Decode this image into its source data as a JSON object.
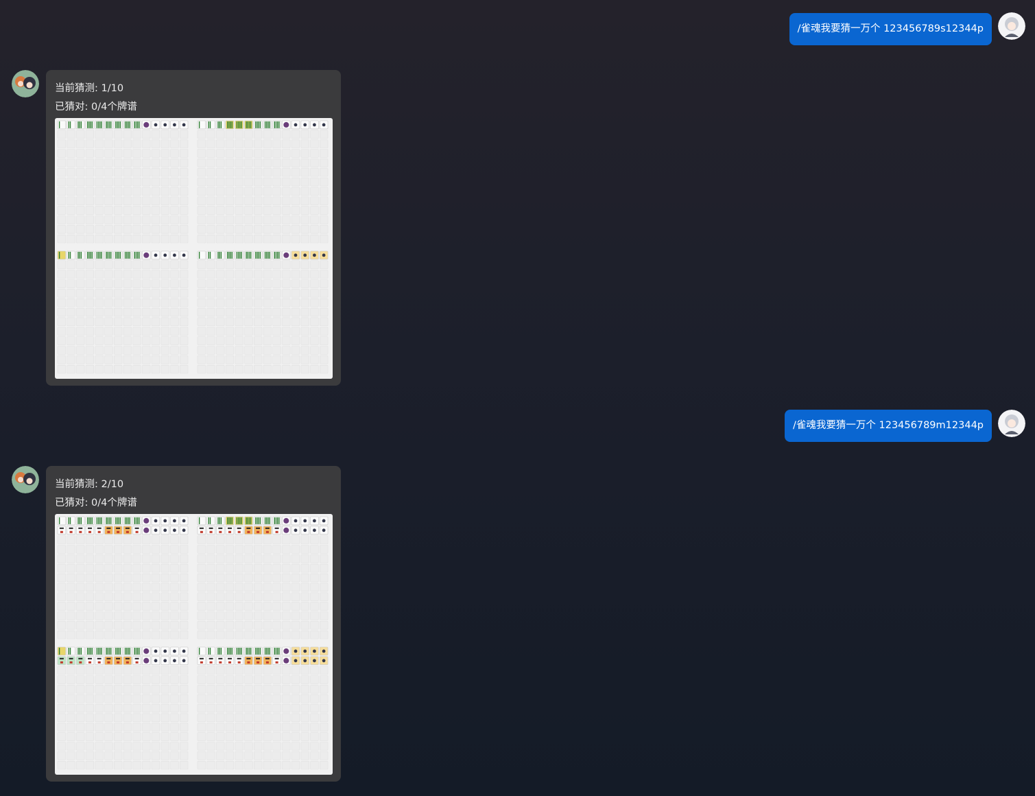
{
  "messages": [
    {
      "role": "user",
      "text": "/雀魂我要猜一万个 123456789s12344p"
    },
    {
      "role": "bot",
      "lines": [
        "当前猜测: 1/10",
        "已猜对: 0/4个牌谱"
      ],
      "guess_rows": 1
    },
    {
      "role": "user",
      "text": "/雀魂我要猜一万个 123456789m12344p"
    },
    {
      "role": "bot",
      "lines": [
        "当前猜测: 2/10",
        "已猜对: 0/4个牌谱"
      ],
      "guess_rows": 2
    }
  ],
  "colors": {
    "user_bubble": "#0a66d1",
    "bot_card": "#3b3b3d",
    "board_bg": "#f1f1f1",
    "tile_green": "#2e7d32",
    "tile_yellow": "#e8d66a",
    "tile_orange": "#f2b35a"
  },
  "icons": {
    "user_avatar": "silver-hair-character-icon",
    "bot_avatar": "two-anime-girls-icon"
  }
}
